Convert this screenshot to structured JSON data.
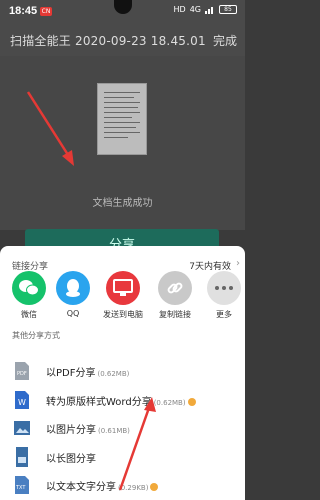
{
  "status_bar": {
    "time": "18:45",
    "badge": "CN",
    "net": "HD",
    "signal": "4G",
    "battery": "85"
  },
  "app_bar": {
    "title": "扫描全能王 2020-09-23 18.45.01",
    "done_label": "完成"
  },
  "preview": {
    "success_text": "文档生成成功"
  },
  "primary_button": {
    "label": "分享"
  },
  "sheet": {
    "link_share_label": "链接分享",
    "validity_text": "7天内有效",
    "targets": [
      {
        "label": "微信",
        "icon": "wechat-icon",
        "color": "#15c26b"
      },
      {
        "label": "QQ",
        "icon": "qq-icon",
        "color": "#2aa4ee"
      },
      {
        "label": "发送到电脑",
        "icon": "computer-icon",
        "color": "#e8383d"
      },
      {
        "label": "复制链接",
        "icon": "link-icon",
        "color": "#c9c9c9"
      },
      {
        "label": "更多",
        "icon": "more-icon",
        "color": "#e0e0e0"
      }
    ],
    "other_label": "其他分享方式",
    "options": [
      {
        "label": "以PDF分享",
        "size": "(0.62MB)",
        "icon": "pdf-icon",
        "premium": false
      },
      {
        "label": "转为原版样式Word分享",
        "size": "(0.62MB)",
        "icon": "word-icon",
        "premium": true
      },
      {
        "label": "以图片分享",
        "size": "(0.61MB)",
        "icon": "image-icon",
        "premium": false
      },
      {
        "label": "以长图分享",
        "size": "",
        "icon": "long-image-icon",
        "premium": false
      },
      {
        "label": "以文本文字分享",
        "size": "(0.29KB)",
        "icon": "txt-icon",
        "premium": true
      }
    ]
  },
  "colors": {
    "accent": "#1d6b5b",
    "annotation_arrow": "#e53935"
  }
}
